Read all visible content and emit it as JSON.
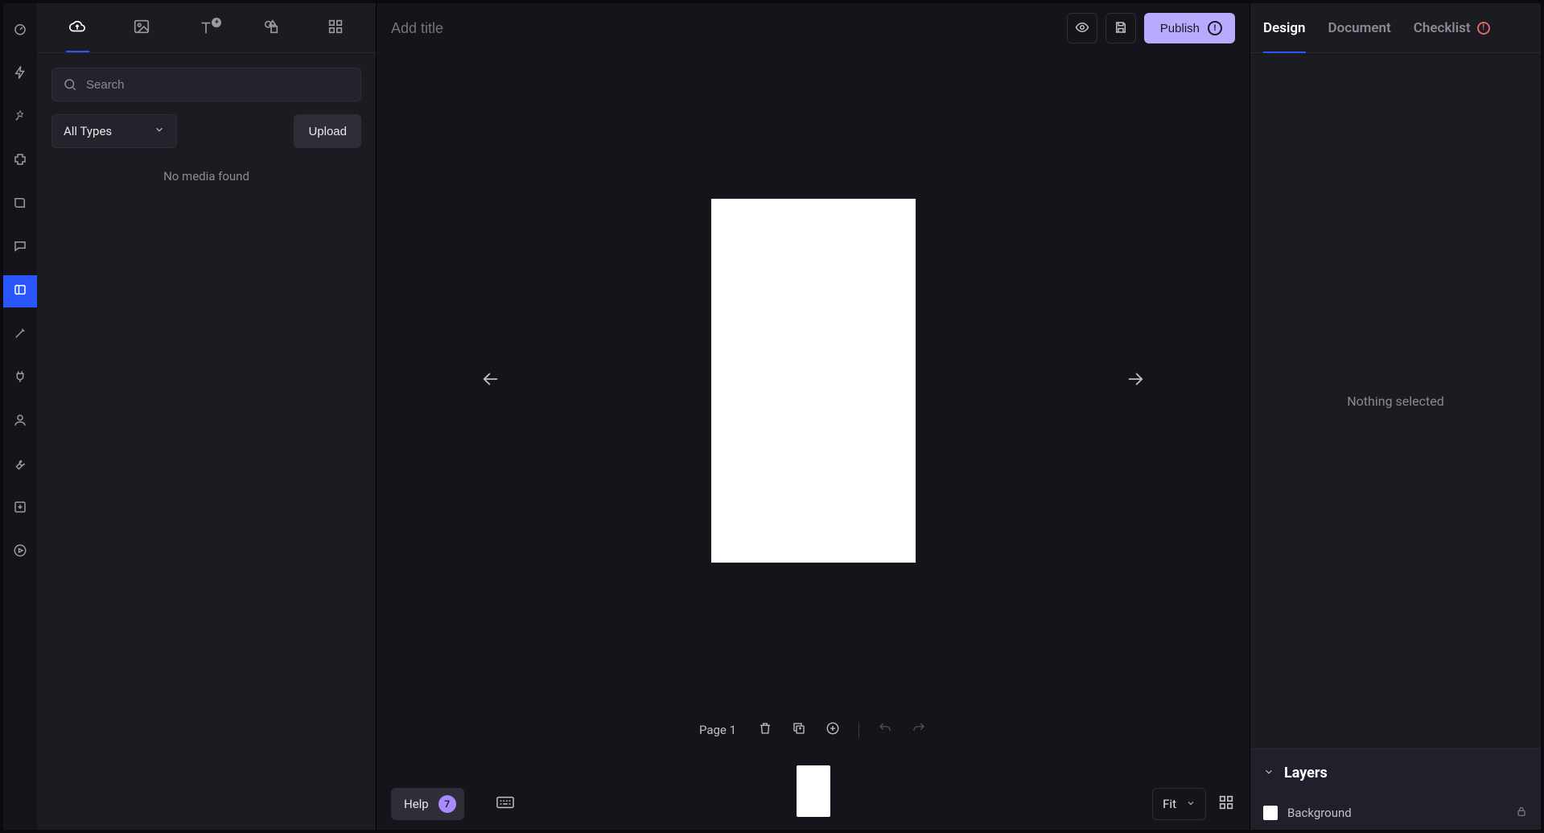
{
  "colors": {
    "accent": "#2a56ff",
    "publish": "#b9a9ff",
    "alert": "#e06565"
  },
  "leftPanel": {
    "search": {
      "placeholder": "Search"
    },
    "filter": {
      "selected": "All Types"
    },
    "upload_label": "Upload",
    "empty_message": "No media found"
  },
  "header": {
    "title_placeholder": "Add title",
    "publish_label": "Publish"
  },
  "canvas": {
    "page_label": "Page 1",
    "zoom_selected": "Fit"
  },
  "footer": {
    "help_label": "Help",
    "help_count": "7"
  },
  "rightPanel": {
    "tabs": {
      "design": "Design",
      "document": "Document",
      "checklist": "Checklist"
    },
    "nothing_selected": "Nothing selected",
    "layers_title": "Layers",
    "layers": [
      {
        "name": "Background"
      }
    ]
  }
}
